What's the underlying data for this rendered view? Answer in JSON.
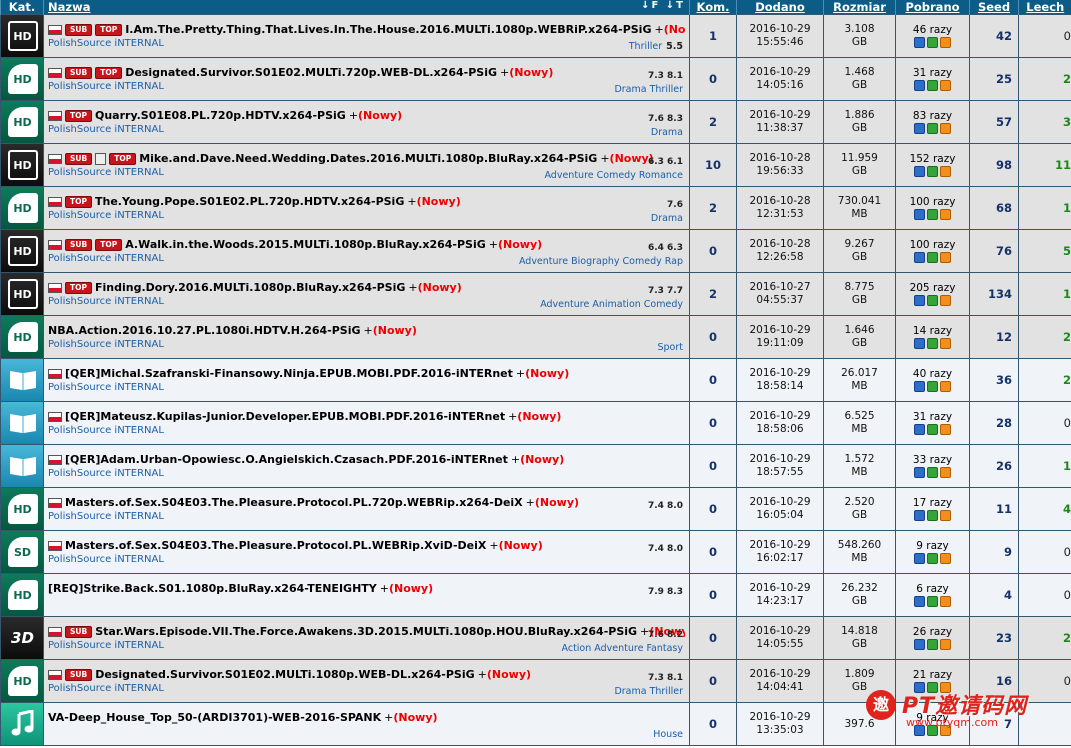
{
  "header": {
    "kat": "Kat.",
    "nazwa": "Nazwa",
    "sort_icons": "↓F ↓T",
    "kom": "Kom.",
    "dodano": "Dodano",
    "rozmiar": "Rozmiar",
    "pobrano": "Pobrano",
    "seed": "Seed",
    "leech": "Leech"
  },
  "rows": [
    {
      "cat": "hd-dark",
      "cat_label": "HD",
      "flag": true,
      "tags": [
        "SUB",
        "TOP"
      ],
      "lock": false,
      "title": "I.Am.The.Pretty.Thing.That.Lives.In.The.House.2016.MULTi.1080p.WEBRiP.x264-PSiG",
      "nowy": "(Nowy)",
      "uploader": "PolishSource iNTERNAL",
      "ratings": "",
      "genres": "Thriller",
      "score": "5.5",
      "kom": "1",
      "date": "2016-10-29",
      "time": "15:55:46",
      "size": "3.108",
      "unit": "GB",
      "pob": "46 razy",
      "seed": "42",
      "leech": "0",
      "shade": "gray"
    },
    {
      "cat": "hd-green",
      "cat_label": "HD",
      "flag": true,
      "tags": [
        "SUB",
        "TOP"
      ],
      "lock": false,
      "title": "Designated.Survivor.S01E02.MULTi.720p.WEB-DL.x264-PSiG",
      "nowy": "(Nowy)",
      "uploader": "PolishSource iNTERNAL",
      "ratings": "7.3  8.1",
      "genres": "Drama Thriller",
      "score": "",
      "kom": "0",
      "date": "2016-10-29",
      "time": "14:05:16",
      "size": "1.468",
      "unit": "GB",
      "pob": "31 razy",
      "seed": "25",
      "leech": "2",
      "shade": "gray"
    },
    {
      "cat": "hd-green",
      "cat_label": "HD",
      "flag": true,
      "tags": [
        "TOP"
      ],
      "lock": false,
      "title": "Quarry.S01E08.PL.720p.HDTV.x264-PSiG",
      "nowy": "(Nowy)",
      "uploader": "PolishSource iNTERNAL",
      "ratings": "7.6  8.3",
      "genres": "Drama",
      "score": "",
      "kom": "2",
      "date": "2016-10-29",
      "time": "11:38:37",
      "size": "1.886",
      "unit": "GB",
      "pob": "83 razy",
      "seed": "57",
      "leech": "3",
      "shade": "gray"
    },
    {
      "cat": "hd-dark",
      "cat_label": "HD",
      "flag": true,
      "tags": [
        "SUB"
      ],
      "lock": true,
      "tags2": [
        "TOP"
      ],
      "title": "Mike.and.Dave.Need.Wedding.Dates.2016.MULTi.1080p.BluRay.x264-PSiG",
      "nowy": "(Nowy)",
      "uploader": "PolishSource iNTERNAL",
      "ratings": "6.3  6.1",
      "genres": "Adventure Comedy Romance",
      "score": "",
      "kom": "10",
      "date": "2016-10-28",
      "time": "19:56:33",
      "size": "11.959",
      "unit": "GB",
      "pob": "152 razy",
      "seed": "98",
      "leech": "11",
      "shade": "gray"
    },
    {
      "cat": "hd-green",
      "cat_label": "HD",
      "flag": true,
      "tags": [
        "TOP"
      ],
      "lock": false,
      "title": "The.Young.Pope.S01E02.PL.720p.HDTV.x264-PSiG",
      "nowy": "(Nowy)",
      "uploader": "PolishSource iNTERNAL",
      "ratings": "7.6",
      "genres": "Drama",
      "score": "",
      "kom": "2",
      "date": "2016-10-28",
      "time": "12:31:53",
      "size": "730.041",
      "unit": "MB",
      "pob": "100 razy",
      "seed": "68",
      "leech": "1",
      "shade": "gray"
    },
    {
      "cat": "hd-dark",
      "cat_label": "HD",
      "flag": true,
      "tags": [
        "SUB",
        "TOP"
      ],
      "lock": false,
      "title": "A.Walk.in.the.Woods.2015.MULTi.1080p.BluRay.x264-PSiG",
      "nowy": "(Nowy)",
      "uploader": "PolishSource iNTERNAL",
      "ratings": "6.4  6.3",
      "genres": "Adventure Biography Comedy Rap",
      "score": "",
      "kom": "0",
      "date": "2016-10-28",
      "time": "12:26:58",
      "size": "9.267",
      "unit": "GB",
      "pob": "100 razy",
      "seed": "76",
      "leech": "5",
      "shade": "gray"
    },
    {
      "cat": "hd-dark",
      "cat_label": "HD",
      "flag": true,
      "tags": [
        "TOP"
      ],
      "lock": false,
      "title": "Finding.Dory.2016.MULTi.1080p.BluRay.x264-PSiG",
      "nowy": "(Nowy)",
      "uploader": "PolishSource iNTERNAL",
      "ratings": "7.3  7.7",
      "genres": "Adventure Animation Comedy",
      "score": "",
      "kom": "2",
      "date": "2016-10-27",
      "time": "04:55:37",
      "size": "8.775",
      "unit": "GB",
      "pob": "205 razy",
      "seed": "134",
      "leech": "1",
      "shade": "gray"
    },
    {
      "cat": "hd-green",
      "cat_label": "HD",
      "flag": false,
      "tags": [],
      "lock": false,
      "title": "NBA.Action.2016.10.27.PL.1080i.HDTV.H.264-PSiG",
      "nowy": "(Nowy)",
      "uploader": "PolishSource iNTERNAL",
      "ratings": "",
      "genres": "Sport",
      "score": "",
      "kom": "0",
      "date": "2016-10-29",
      "time": "19:11:09",
      "size": "1.646",
      "unit": "GB",
      "pob": "14 razy",
      "seed": "12",
      "leech": "2",
      "shade": "gray"
    },
    {
      "cat": "book",
      "cat_label": "",
      "flag": true,
      "tags": [],
      "lock": false,
      "title": "[QER]Michal.Szafranski-Finansowy.Ninja.EPUB.MOBI.PDF.2016-iNTERnet",
      "nowy": "(Nowy)",
      "uploader": "PolishSource iNTERNAL",
      "ratings": "",
      "genres": "",
      "score": "",
      "kom": "0",
      "date": "2016-10-29",
      "time": "18:58:14",
      "size": "26.017",
      "unit": "MB",
      "pob": "40 razy",
      "seed": "36",
      "leech": "2",
      "shade": "white"
    },
    {
      "cat": "book",
      "cat_label": "",
      "flag": true,
      "tags": [],
      "lock": false,
      "title": "[QER]Mateusz.Kupilas-Junior.Developer.EPUB.MOBI.PDF.2016-iNTERnet",
      "nowy": "(Nowy)",
      "uploader": "PolishSource iNTERNAL",
      "ratings": "",
      "genres": "",
      "score": "",
      "kom": "0",
      "date": "2016-10-29",
      "time": "18:58:06",
      "size": "6.525",
      "unit": "MB",
      "pob": "31 razy",
      "seed": "28",
      "leech": "0",
      "shade": "white"
    },
    {
      "cat": "book",
      "cat_label": "",
      "flag": true,
      "tags": [],
      "lock": false,
      "title": "[QER]Adam.Urban-Opowiesc.O.Angielskich.Czasach.PDF.2016-iNTERnet",
      "nowy": "(Nowy)",
      "uploader": "PolishSource iNTERNAL",
      "ratings": "",
      "genres": "",
      "score": "",
      "kom": "0",
      "date": "2016-10-29",
      "time": "18:57:55",
      "size": "1.572",
      "unit": "MB",
      "pob": "33 razy",
      "seed": "26",
      "leech": "1",
      "shade": "white"
    },
    {
      "cat": "hd-green",
      "cat_label": "HD",
      "flag": true,
      "tags": [],
      "lock": false,
      "title": "Masters.of.Sex.S04E03.The.Pleasure.Protocol.PL.720p.WEBRip.x264-DeiX",
      "nowy": "(Nowy)",
      "uploader": "PolishSource iNTERNAL",
      "ratings": "7.4  8.0",
      "genres": "",
      "score": "",
      "kom": "0",
      "date": "2016-10-29",
      "time": "16:05:04",
      "size": "2.520",
      "unit": "GB",
      "pob": "17 razy",
      "seed": "11",
      "leech": "4",
      "shade": "white"
    },
    {
      "cat": "sd-green",
      "cat_label": "SD",
      "flag": true,
      "tags": [],
      "lock": false,
      "title": "Masters.of.Sex.S04E03.The.Pleasure.Protocol.PL.WEBRip.XviD-DeiX",
      "nowy": "(Nowy)",
      "uploader": "PolishSource iNTERNAL",
      "ratings": "7.4  8.0",
      "genres": "",
      "score": "",
      "kom": "0",
      "date": "2016-10-29",
      "time": "16:02:17",
      "size": "548.260",
      "unit": "MB",
      "pob": "9 razy",
      "seed": "9",
      "leech": "0",
      "shade": "white"
    },
    {
      "cat": "hd-green",
      "cat_label": "HD",
      "flag": false,
      "tags": [],
      "lock": false,
      "title": "[REQ]Strike.Back.S01.1080p.BluRay.x264-TENEIGHTY",
      "nowy": "(Nowy)",
      "uploader": "",
      "ratings": "7.9  8.3",
      "genres": "",
      "score": "",
      "kom": "0",
      "date": "2016-10-29",
      "time": "14:23:17",
      "size": "26.232",
      "unit": "GB",
      "pob": "6 razy",
      "seed": "4",
      "leech": "0",
      "shade": "white"
    },
    {
      "cat": "3d",
      "cat_label": "3D",
      "flag": true,
      "tags": [
        "SUB"
      ],
      "lock": false,
      "title": "Star.Wars.Episode.VII.The.Force.Awakens.3D.2015.MULTi.1080p.HOU.BluRay.x264-PSiG",
      "nowy": "(Nowy)",
      "uploader": "PolishSource iNTERNAL",
      "ratings": "7.6  8.2",
      "genres": "Action Adventure Fantasy",
      "score": "",
      "kom": "0",
      "date": "2016-10-29",
      "time": "14:05:55",
      "size": "14.818",
      "unit": "GB",
      "pob": "26 razy",
      "seed": "23",
      "leech": "2",
      "shade": "gray"
    },
    {
      "cat": "hd-green",
      "cat_label": "HD",
      "flag": true,
      "tags": [
        "SUB"
      ],
      "lock": false,
      "title": "Designated.Survivor.S01E02.MULTi.1080p.WEB-DL.x264-PSiG",
      "nowy": "(Nowy)",
      "uploader": "PolishSource iNTERNAL",
      "ratings": "7.3  8.1",
      "genres": "Drama Thriller",
      "score": "",
      "kom": "0",
      "date": "2016-10-29",
      "time": "14:04:41",
      "size": "1.809",
      "unit": "GB",
      "pob": "21 razy",
      "seed": "16",
      "leech": "0",
      "shade": "gray"
    },
    {
      "cat": "music",
      "cat_label": "",
      "flag": false,
      "tags": [],
      "lock": false,
      "title": "VA-Deep_House_Top_50-(ARDI3701)-WEB-2016-SPANK",
      "nowy": "(Nowy)",
      "uploader": "",
      "ratings": "",
      "genres": "House",
      "score": "",
      "kom": "0",
      "date": "2016-10-29",
      "time": "13:35:03",
      "size": "397.6",
      "unit": "",
      "pob": "9 razy",
      "seed": "7",
      "leech": "",
      "shade": "white"
    }
  ],
  "watermark": {
    "title": "PT邀请码网",
    "url": "www.ptyqm.com",
    "logo": "邀"
  },
  "colors": {
    "header_bg": "#0b5d87",
    "nowy": "#ee0000",
    "uploader": "#1a5fa8",
    "tag": "#c8151b"
  }
}
